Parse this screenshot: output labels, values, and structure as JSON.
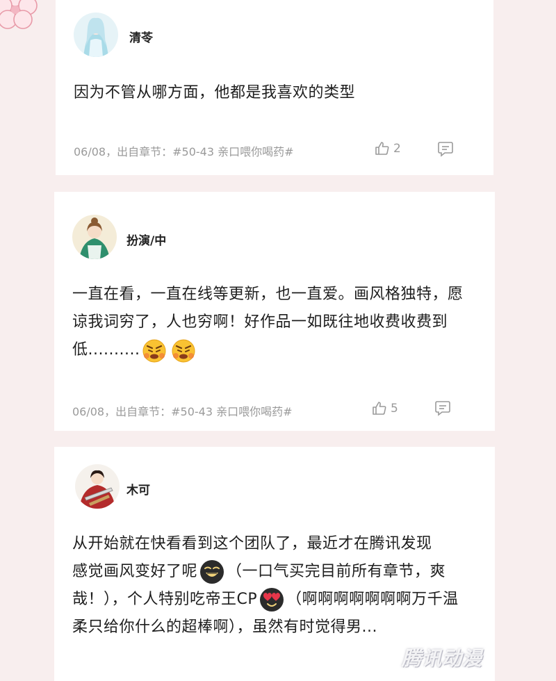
{
  "comments": [
    {
      "username": "清苓",
      "content": "因为不管从哪方面，他都是我喜欢的类型",
      "meta": "06/08，出自章节：#50-43 亲口喂你喝药#",
      "likes": "2",
      "like_icon": "thumbs-up-icon",
      "reply_icon": "comment-icon"
    },
    {
      "username": "扮演/中",
      "content_line1": "一直在看，一直在线等更新，也一直爱。画风格独特，愿",
      "content_line2": "谅我词穷了，人也穷啊！好作品一如既往地收费收费到",
      "content_line3": "低..........",
      "meta": "06/08，出自章节：#50-43 亲口喂你喝药#",
      "likes": "5",
      "like_icon": "thumbs-up-icon",
      "reply_icon": "comment-icon"
    },
    {
      "username": "木可",
      "content_line1": "从开始就在快看看到这个团队了，最近才在腾讯发现",
      "content_line2a": "感觉画风变好了呢",
      "content_line2b": "（一口气买完目前所有章节，爽",
      "content_line3a": "哉！），个人特别吃帝王CP",
      "content_line3b": "（啊啊啊啊啊啊啊万千温",
      "content_line4": "柔只给你什么的超棒啊），虽然有时觉得男..."
    }
  ],
  "watermark": "腾讯动漫",
  "colors": {
    "background": "#f8eeee",
    "card": "#ffffff",
    "meta_text": "#9a9a9a"
  }
}
